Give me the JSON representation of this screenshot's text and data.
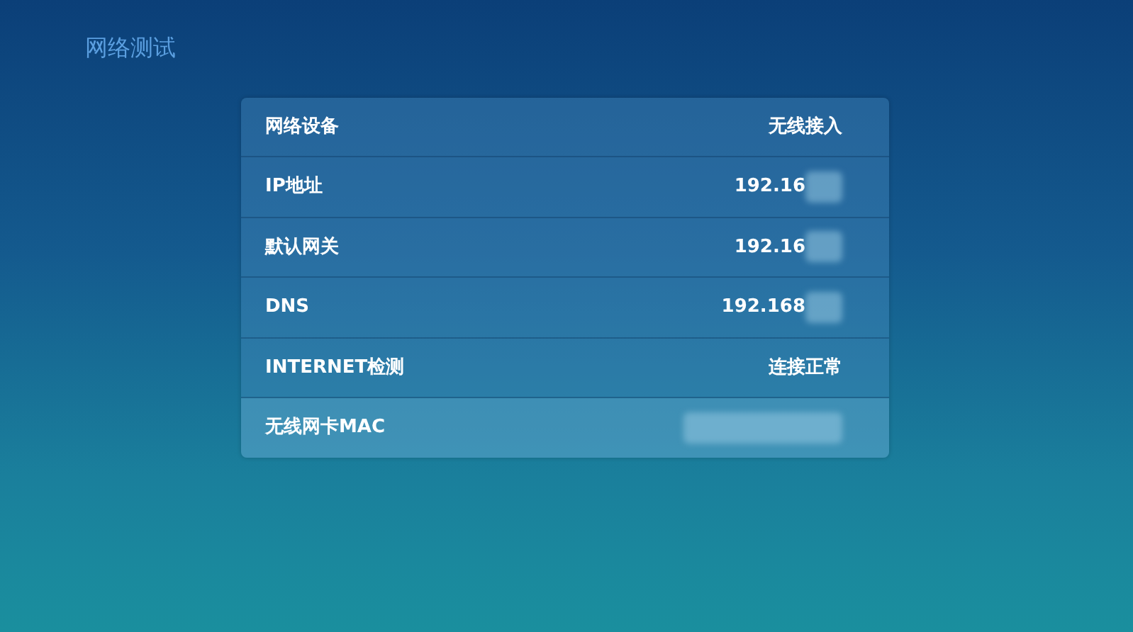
{
  "title": "网络测试",
  "rows": [
    {
      "label": "网络设备",
      "value": "无线接入",
      "redacted": false,
      "selected": false
    },
    {
      "label": "IP地址",
      "value": "192.16",
      "redacted": true,
      "selected": false
    },
    {
      "label": "默认网关",
      "value": "192.16",
      "redacted": true,
      "selected": false
    },
    {
      "label": "DNS",
      "value": "192.168",
      "redacted": true,
      "selected": false
    },
    {
      "label": "INTERNET检测",
      "value": "连接正常",
      "redacted": false,
      "selected": false
    },
    {
      "label": "无线网卡MAC",
      "redacted": true,
      "selected": true
    }
  ]
}
